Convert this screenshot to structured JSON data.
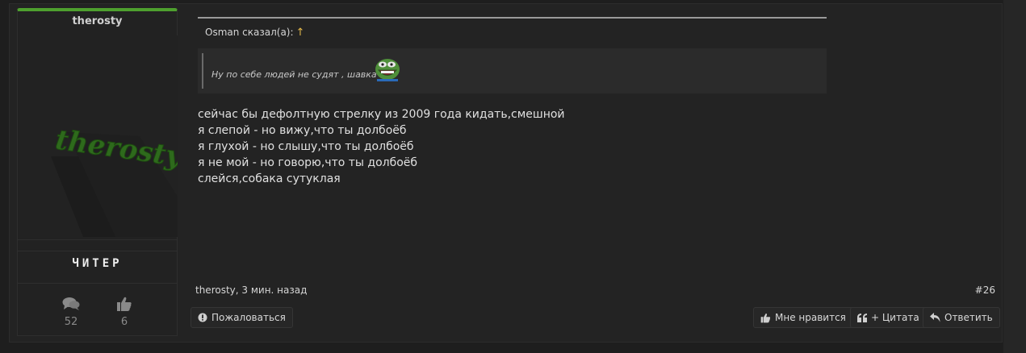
{
  "user": {
    "name": "therosty",
    "avatar_text": "therosty",
    "title": "ЧИТЕР",
    "stats": {
      "messages": "52",
      "likes": "6"
    }
  },
  "quote": {
    "author_line": "Osman сказал(а):",
    "arrow": "↑",
    "text": "Ну по себе людей не судят , шавка"
  },
  "message": {
    "lines": [
      "сейчас бы дефолтную стрелку из 2009 года кидать,смешной",
      "я слепой - но вижу,что ты долбоёб",
      "я глухой - но слышу,что ты долбоёб",
      "я не мой - но говорю,что ты долбоёб",
      "слейся,собака сутуклая"
    ]
  },
  "footer": {
    "meta": "therosty, 3 мин. назад",
    "post_number": "#26",
    "report_label": "Пожаловаться",
    "like_label": "Мне нравится",
    "quote_label": "+ Цитата",
    "reply_label": "Ответить"
  },
  "colors": {
    "accent_green": "#4ea02e",
    "quote_arrow": "#e4b94a"
  },
  "icons": [
    "messages-icon",
    "thumbs-up-icon",
    "report-icon",
    "like-icon",
    "quote-icon",
    "reply-icon",
    "pepe-smile-icon"
  ]
}
